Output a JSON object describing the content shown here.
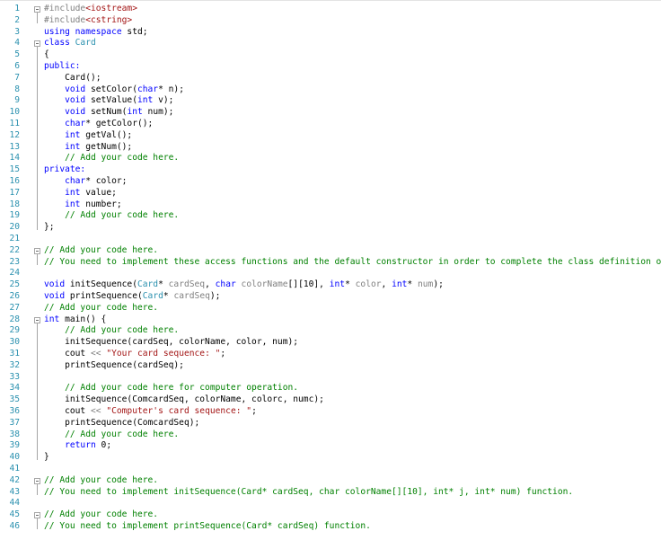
{
  "editor": {
    "lines": [
      {
        "num": "1",
        "fold": true,
        "tokens": [
          {
            "t": "#include",
            "c": "p"
          },
          {
            "t": "<iostream>",
            "c": "s"
          }
        ]
      },
      {
        "num": "2",
        "tokens": [
          {
            "t": "#include",
            "c": "p"
          },
          {
            "t": "<cstring>",
            "c": "s"
          }
        ]
      },
      {
        "num": "3",
        "tokens": [
          {
            "t": "using namespace ",
            "c": "k"
          },
          {
            "t": "std;",
            "c": "n"
          }
        ]
      },
      {
        "num": "4",
        "fold": true,
        "tokens": [
          {
            "t": "class ",
            "c": "k"
          },
          {
            "t": "Card",
            "c": "t"
          }
        ]
      },
      {
        "num": "5",
        "tokens": [
          {
            "t": "{",
            "c": "n"
          }
        ]
      },
      {
        "num": "6",
        "tokens": [
          {
            "t": "public:",
            "c": "k"
          }
        ]
      },
      {
        "num": "7",
        "tokens": [
          {
            "t": "    Card();",
            "c": "n"
          }
        ]
      },
      {
        "num": "8",
        "tokens": [
          {
            "t": "    ",
            "c": "n"
          },
          {
            "t": "void ",
            "c": "k"
          },
          {
            "t": "setColor(",
            "c": "n"
          },
          {
            "t": "char",
            "c": "k"
          },
          {
            "t": "* n);",
            "c": "n"
          }
        ]
      },
      {
        "num": "9",
        "tokens": [
          {
            "t": "    ",
            "c": "n"
          },
          {
            "t": "void ",
            "c": "k"
          },
          {
            "t": "setValue(",
            "c": "n"
          },
          {
            "t": "int ",
            "c": "k"
          },
          {
            "t": "v);",
            "c": "n"
          }
        ]
      },
      {
        "num": "10",
        "tokens": [
          {
            "t": "    ",
            "c": "n"
          },
          {
            "t": "void ",
            "c": "k"
          },
          {
            "t": "setNum(",
            "c": "n"
          },
          {
            "t": "int ",
            "c": "k"
          },
          {
            "t": "num);",
            "c": "n"
          }
        ]
      },
      {
        "num": "11",
        "tokens": [
          {
            "t": "    ",
            "c": "n"
          },
          {
            "t": "char",
            "c": "k"
          },
          {
            "t": "* getColor();",
            "c": "n"
          }
        ]
      },
      {
        "num": "12",
        "tokens": [
          {
            "t": "    ",
            "c": "n"
          },
          {
            "t": "int ",
            "c": "k"
          },
          {
            "t": "getVal();",
            "c": "n"
          }
        ]
      },
      {
        "num": "13",
        "tokens": [
          {
            "t": "    ",
            "c": "n"
          },
          {
            "t": "int ",
            "c": "k"
          },
          {
            "t": "getNum();",
            "c": "n"
          }
        ]
      },
      {
        "num": "14",
        "tokens": [
          {
            "t": "    // Add your code here.",
            "c": "c"
          }
        ]
      },
      {
        "num": "15",
        "tokens": [
          {
            "t": "private:",
            "c": "k"
          }
        ]
      },
      {
        "num": "16",
        "tokens": [
          {
            "t": "    ",
            "c": "n"
          },
          {
            "t": "char",
            "c": "k"
          },
          {
            "t": "* color;",
            "c": "n"
          }
        ]
      },
      {
        "num": "17",
        "tokens": [
          {
            "t": "    ",
            "c": "n"
          },
          {
            "t": "int ",
            "c": "k"
          },
          {
            "t": "value;",
            "c": "n"
          }
        ]
      },
      {
        "num": "18",
        "tokens": [
          {
            "t": "    ",
            "c": "n"
          },
          {
            "t": "int ",
            "c": "k"
          },
          {
            "t": "number;",
            "c": "n"
          }
        ]
      },
      {
        "num": "19",
        "tokens": [
          {
            "t": "    // Add your code here.",
            "c": "c"
          }
        ]
      },
      {
        "num": "20",
        "tokens": [
          {
            "t": "};",
            "c": "n"
          }
        ]
      },
      {
        "num": "21",
        "tokens": []
      },
      {
        "num": "22",
        "fold": true,
        "tokens": [
          {
            "t": "// Add your code here.",
            "c": "c"
          }
        ]
      },
      {
        "num": "23",
        "tokens": [
          {
            "t": "// You need to implement these access functions and the default constructor in order to complete the class definition of Card.",
            "c": "c"
          }
        ]
      },
      {
        "num": "24",
        "tokens": []
      },
      {
        "num": "25",
        "tokens": [
          {
            "t": "void ",
            "c": "k"
          },
          {
            "t": "initSequence(",
            "c": "n"
          },
          {
            "t": "Card",
            "c": "t"
          },
          {
            "t": "* ",
            "c": "n"
          },
          {
            "t": "cardSeq",
            "c": "p"
          },
          {
            "t": ", ",
            "c": "n"
          },
          {
            "t": "char ",
            "c": "k"
          },
          {
            "t": "colorName",
            "c": "p"
          },
          {
            "t": "[][10], ",
            "c": "n"
          },
          {
            "t": "int",
            "c": "k"
          },
          {
            "t": "* ",
            "c": "n"
          },
          {
            "t": "color",
            "c": "p"
          },
          {
            "t": ", ",
            "c": "n"
          },
          {
            "t": "int",
            "c": "k"
          },
          {
            "t": "* ",
            "c": "n"
          },
          {
            "t": "num",
            "c": "p"
          },
          {
            "t": ");",
            "c": "n"
          }
        ]
      },
      {
        "num": "26",
        "tokens": [
          {
            "t": "void ",
            "c": "k"
          },
          {
            "t": "printSequence(",
            "c": "n"
          },
          {
            "t": "Card",
            "c": "t"
          },
          {
            "t": "* ",
            "c": "n"
          },
          {
            "t": "cardSeq",
            "c": "p"
          },
          {
            "t": ");",
            "c": "n"
          }
        ]
      },
      {
        "num": "27",
        "tokens": [
          {
            "t": "// Add your code here.",
            "c": "c"
          }
        ]
      },
      {
        "num": "28",
        "fold": true,
        "tokens": [
          {
            "t": "int ",
            "c": "k"
          },
          {
            "t": "main() {",
            "c": "n"
          }
        ]
      },
      {
        "num": "29",
        "tokens": [
          {
            "t": "    // Add your code here.",
            "c": "c"
          }
        ]
      },
      {
        "num": "30",
        "tokens": [
          {
            "t": "    initSequence(cardSeq, colorName, color, num);",
            "c": "n"
          }
        ]
      },
      {
        "num": "31",
        "tokens": [
          {
            "t": "    cout ",
            "c": "n"
          },
          {
            "t": "<<",
            "c": "p"
          },
          {
            "t": " ",
            "c": "n"
          },
          {
            "t": "\"Your card sequence: \"",
            "c": "s"
          },
          {
            "t": ";",
            "c": "n"
          }
        ]
      },
      {
        "num": "32",
        "tokens": [
          {
            "t": "    printSequence(cardSeq);",
            "c": "n"
          }
        ]
      },
      {
        "num": "33",
        "tokens": []
      },
      {
        "num": "34",
        "tokens": [
          {
            "t": "    // Add your code here for computer operation.",
            "c": "c"
          }
        ]
      },
      {
        "num": "35",
        "tokens": [
          {
            "t": "    initSequence(ComcardSeq, colorName, colorc, numc);",
            "c": "n"
          }
        ]
      },
      {
        "num": "36",
        "tokens": [
          {
            "t": "    cout ",
            "c": "n"
          },
          {
            "t": "<<",
            "c": "p"
          },
          {
            "t": " ",
            "c": "n"
          },
          {
            "t": "\"Computer's card sequence: \"",
            "c": "s"
          },
          {
            "t": ";",
            "c": "n"
          }
        ]
      },
      {
        "num": "37",
        "tokens": [
          {
            "t": "    printSequence(ComcardSeq);",
            "c": "n"
          }
        ]
      },
      {
        "num": "38",
        "tokens": [
          {
            "t": "    // Add your code here.",
            "c": "c"
          }
        ]
      },
      {
        "num": "39",
        "tokens": [
          {
            "t": "    ",
            "c": "n"
          },
          {
            "t": "return ",
            "c": "k"
          },
          {
            "t": "0;",
            "c": "n"
          }
        ]
      },
      {
        "num": "40",
        "tokens": [
          {
            "t": "}",
            "c": "n"
          }
        ]
      },
      {
        "num": "41",
        "tokens": []
      },
      {
        "num": "42",
        "fold": true,
        "tokens": [
          {
            "t": "// Add your code here.",
            "c": "c"
          }
        ]
      },
      {
        "num": "43",
        "tokens": [
          {
            "t": "// You need to implement initSequence(Card* cardSeq, char colorName[][10], int* j, int* num) function.",
            "c": "c"
          }
        ]
      },
      {
        "num": "44",
        "tokens": []
      },
      {
        "num": "45",
        "fold": true,
        "tokens": [
          {
            "t": "// Add your code here.",
            "c": "c"
          }
        ]
      },
      {
        "num": "46",
        "tokens": [
          {
            "t": "// You need to implement printSequence(Card* cardSeq) function.",
            "c": "c"
          }
        ]
      }
    ]
  }
}
